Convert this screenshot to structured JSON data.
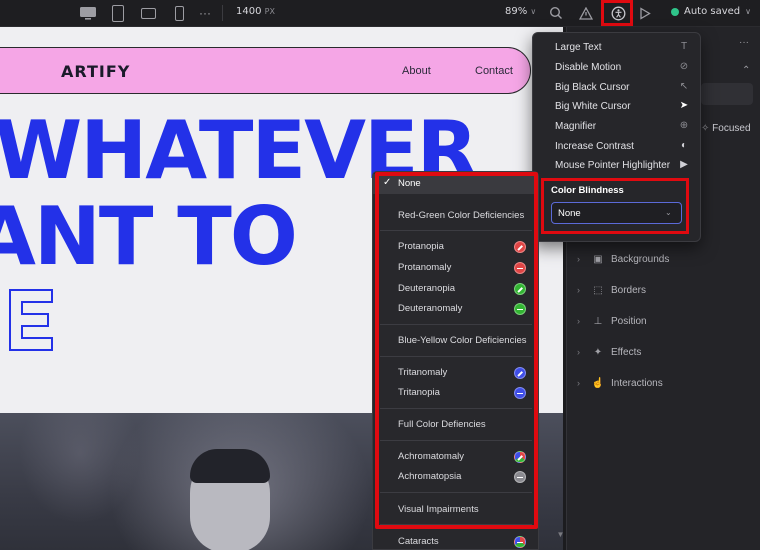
{
  "topbar": {
    "width_value": "1400",
    "width_unit": "PX",
    "zoom": "89%",
    "save_status": "Auto saved",
    "more_glyph": "···",
    "chevron": "∨",
    "search_glyph": "○",
    "warning_glyph": "△",
    "play_glyph": "▷"
  },
  "site": {
    "logo": "ARTIFY",
    "nav_links": [
      "About",
      "Contact"
    ],
    "hero_lines": [
      "WHATEVER",
      "ANT TO"
    ]
  },
  "panel": {
    "more": "···",
    "chevron": "⌃",
    "focused_label": "Focused",
    "sections": [
      {
        "label": "Backgrounds",
        "icon": "image-icon"
      },
      {
        "label": "Borders",
        "icon": "border-icon"
      },
      {
        "label": "Position",
        "icon": "position-icon"
      },
      {
        "label": "Effects",
        "icon": "sparkle-icon"
      },
      {
        "label": "Interactions",
        "icon": "pointer-icon"
      }
    ]
  },
  "a11y_menu": {
    "items": [
      {
        "label": "Large Text",
        "glyph": "T",
        "icon": "text-size-icon"
      },
      {
        "label": "Disable Motion",
        "glyph": "⊘",
        "icon": "motion-off-icon"
      },
      {
        "label": "Big Black Cursor",
        "glyph": "↖",
        "icon": "cursor-outline-icon"
      },
      {
        "label": "Big White Cursor",
        "glyph": "➤",
        "icon": "cursor-filled-icon"
      },
      {
        "label": "Magnifier",
        "glyph": "⊕",
        "icon": "magnifier-icon"
      },
      {
        "label": "Increase Contrast",
        "glyph": "◐",
        "icon": "contrast-icon"
      },
      {
        "label": "Mouse Pointer Highlighter",
        "glyph": "▶",
        "icon": "pointer-highlight-icon"
      }
    ],
    "color_blindness_title": "Color Blindness",
    "color_blindness_value": "None"
  },
  "cb_options": {
    "check": "✓",
    "none": "None",
    "groups": [
      {
        "heading": "Red-Green Color Deficiencies",
        "options": [
          {
            "label": "Protanopia",
            "color": "#e04545",
            "mark": "slash"
          },
          {
            "label": "Protanomaly",
            "color": "#e04545",
            "mark": "minus"
          },
          {
            "label": "Deuteranopia",
            "color": "#33b533",
            "mark": "slash"
          },
          {
            "label": "Deuteranomaly",
            "color": "#33b533",
            "mark": "minus"
          }
        ]
      },
      {
        "heading": "Blue-Yellow Color Deficiencies",
        "options": [
          {
            "label": "Tritanomaly",
            "color": "#3f4ee8",
            "mark": "slash"
          },
          {
            "label": "Tritanopia",
            "color": "#3f4ee8",
            "mark": "minus"
          }
        ]
      },
      {
        "heading": "Full Color Defiencies",
        "options": [
          {
            "label": "Achromatomaly",
            "color": "#7a5fd6",
            "mark": "slash"
          },
          {
            "label": "Achromatopsia",
            "color": "#8a8a90",
            "mark": "minus"
          }
        ]
      },
      {
        "heading": "Visual Impairments",
        "options": [
          {
            "label": "Cataracts",
            "color": "#b04fb8",
            "mark": "minus"
          }
        ]
      }
    ]
  },
  "colors": {
    "accent_red": "#e00a10",
    "brand_blue": "#2331e8",
    "nav_pink": "#f5a6e6",
    "status_green": "#2fc48a"
  }
}
